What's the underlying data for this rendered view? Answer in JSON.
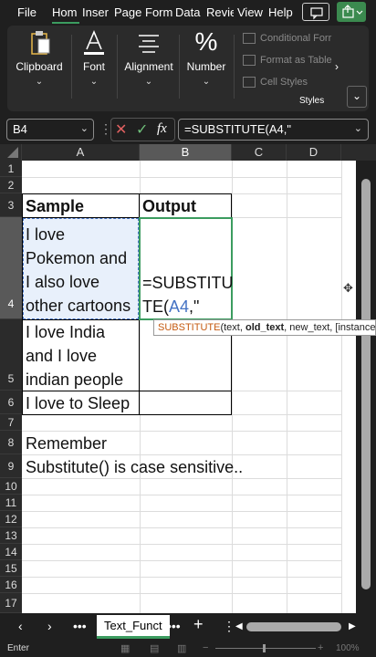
{
  "tabs": [
    "File",
    "Hom",
    "Inser",
    "Page",
    "Form",
    "Data",
    "Revie",
    "View",
    "Help"
  ],
  "ribbon": {
    "clipboard": "Clipboard",
    "font": "Font",
    "alignment": "Alignment",
    "number": "Number",
    "styles_group": "Styles",
    "style_items": [
      "Conditional Forr",
      "Format as Table",
      "Cell Styles"
    ]
  },
  "formula_bar": {
    "name_box": "B4",
    "formula": "=SUBSTITUTE(A4,\"",
    "fx": "fx"
  },
  "columns": [
    "A",
    "B",
    "C",
    "D"
  ],
  "rows": [
    "1",
    "2",
    "3",
    "4",
    "5",
    "6",
    "7",
    "8",
    "9",
    "10",
    "11",
    "12",
    "13",
    "14",
    "15",
    "16",
    "17"
  ],
  "cells": {
    "a3": "Sample",
    "b3": "Output",
    "a4_lines": [
      "I love",
      "Pokemon and",
      "I also love",
      "other cartoons"
    ],
    "b4_line1": "=SUBSTITU",
    "b4_line2_prefix": "TE(",
    "b4_ref": "A4",
    "b4_suffix": ",\"",
    "a5_lines": [
      "I love India",
      "and I love",
      "indian people"
    ],
    "a6": "I love to Sleep",
    "a8": "Remember",
    "a9": "Substitute() is case sensitive.."
  },
  "tooltip": {
    "fn": "SUBSTITUTE",
    "open": "(text, ",
    "current": "old_text",
    "rest": ", new_text, [instance_n"
  },
  "sheet_tab": "Text_Funct",
  "status": "Enter",
  "zoom": "100%",
  "colors": {
    "accent": "#3b9c5f",
    "ref_blue": "#4472c4",
    "fn_orange": "#c55a11"
  }
}
